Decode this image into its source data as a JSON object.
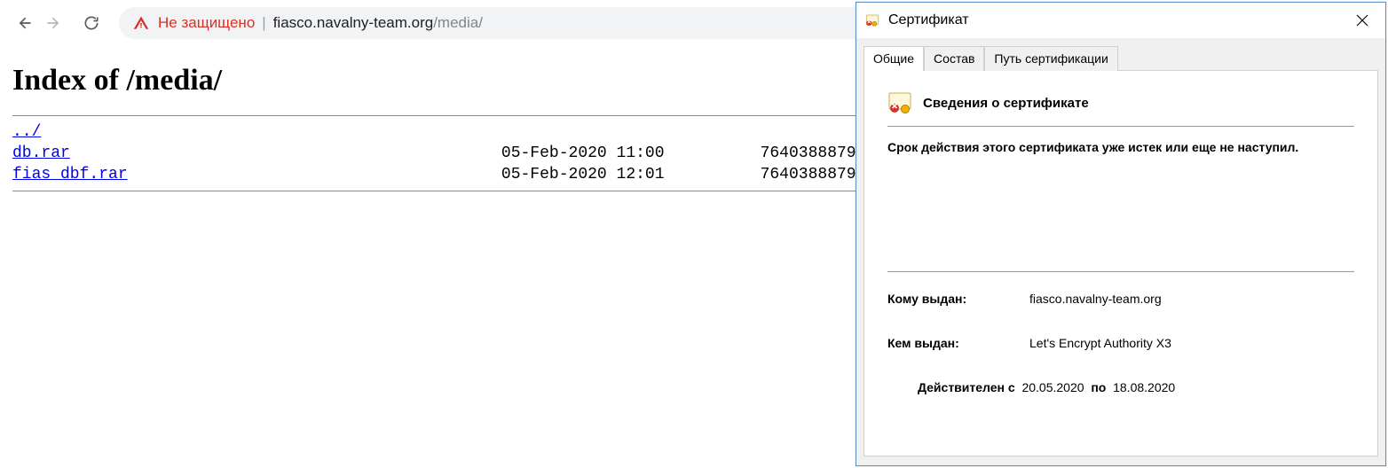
{
  "browser": {
    "insecure_label": "Не защищено",
    "url_host": "fiasco.navalny-team.org",
    "url_path": "/media/"
  },
  "page": {
    "heading": "Index of /media/",
    "parent_link": "../",
    "files": [
      {
        "name": "db.rar",
        "date": "05-Feb-2020 11:00",
        "size": "7640388879"
      },
      {
        "name": "fias_dbf.rar",
        "date": "05-Feb-2020 12:01",
        "size": "7640388879"
      }
    ]
  },
  "cert": {
    "window_title": "Сертификат",
    "tabs": {
      "general": "Общие",
      "details": "Состав",
      "path": "Путь сертификации"
    },
    "info_header": "Сведения о сертификате",
    "warning": "Срок действия этого сертификата уже истек или еще не наступил.",
    "issued_to_label": "Кому выдан:",
    "issued_to": "fiasco.navalny-team.org",
    "issued_by_label": "Кем выдан:",
    "issued_by": "Let's Encrypt Authority X3",
    "valid_label_from": "Действителен с",
    "valid_from": "20.05.2020",
    "valid_label_to": "по",
    "valid_to": "18.08.2020"
  }
}
